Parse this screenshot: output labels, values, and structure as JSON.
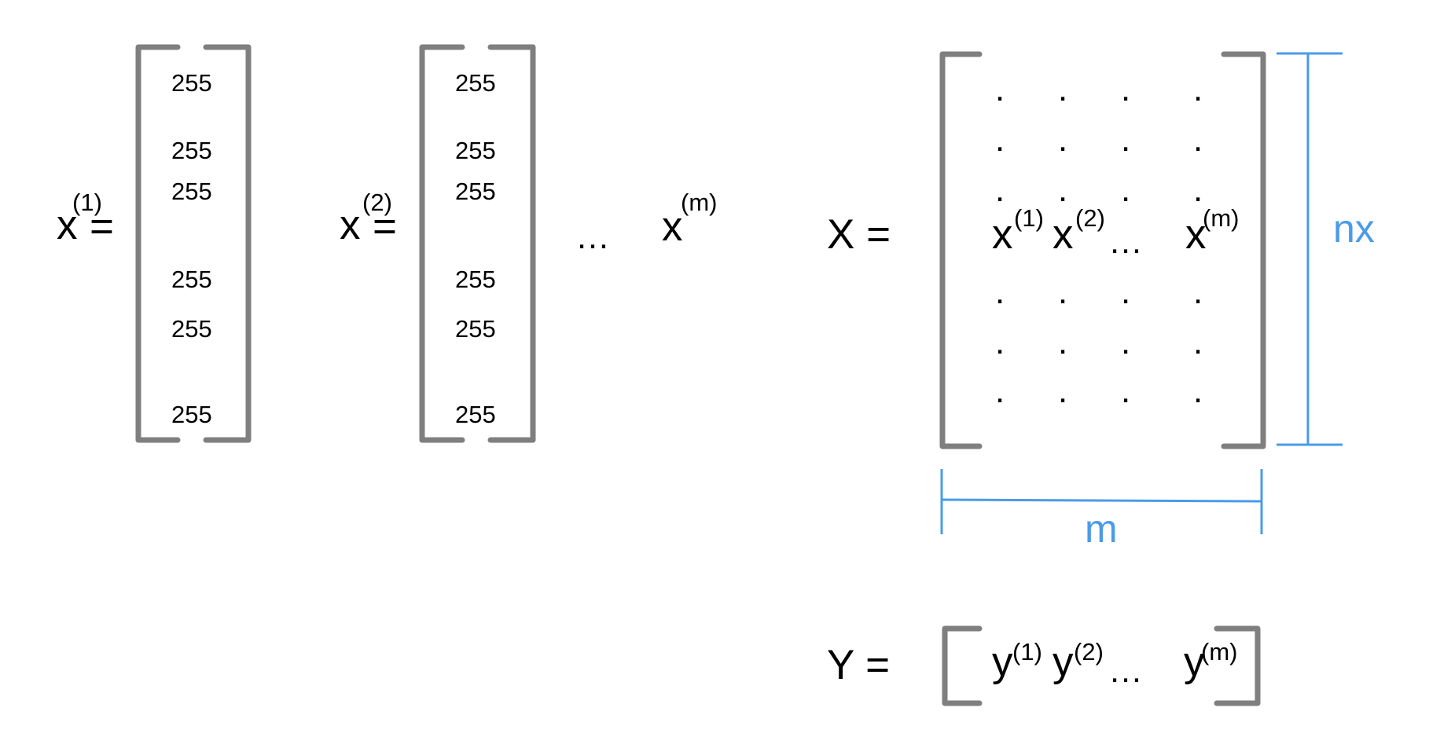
{
  "vectors": [
    {
      "symbol": "x",
      "superscript": "(1)",
      "equals": "=",
      "values": [
        "255",
        "255",
        "255",
        "255",
        "255",
        "255"
      ]
    },
    {
      "symbol": "x",
      "superscript": "(2)",
      "equals": "=",
      "values": [
        "255",
        "255",
        "255",
        "255",
        "255",
        "255"
      ]
    }
  ],
  "ellipsis": "…",
  "last_vector": {
    "symbol": "x",
    "superscript": "(m)"
  },
  "matrix_X": {
    "lhs": "X =",
    "dot": ".",
    "row_entries": [
      {
        "symbol": "x",
        "superscript": "(1)"
      },
      {
        "symbol": "x",
        "superscript": "(2)"
      },
      {
        "symbol": "…",
        "superscript": ""
      },
      {
        "symbol": "x",
        "superscript": "(m)"
      }
    ],
    "height_label": "nx",
    "width_label": "m"
  },
  "matrix_Y": {
    "lhs": "Y =",
    "entries": [
      {
        "symbol": "y",
        "superscript": "(1)"
      },
      {
        "symbol": "y",
        "superscript": "(2)"
      },
      {
        "symbol": "…",
        "superscript": ""
      },
      {
        "symbol": "y",
        "superscript": "(m)"
      }
    ]
  },
  "colors": {
    "bracket": "#7f7f7f",
    "dimension": "#4a9be8",
    "text": "#000000"
  }
}
